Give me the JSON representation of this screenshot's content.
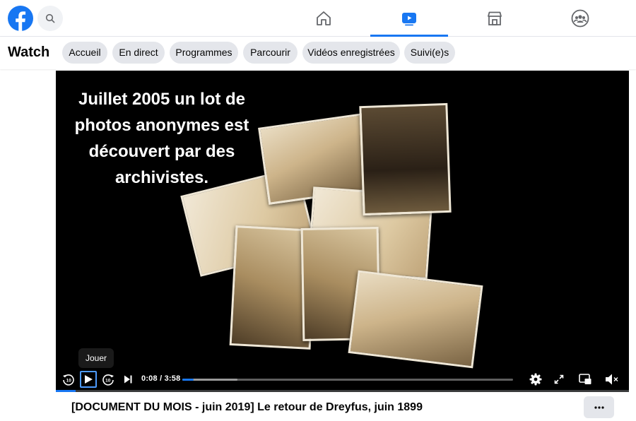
{
  "nav": {
    "tabs": [
      {
        "icon": "home-icon",
        "active": false
      },
      {
        "icon": "watch-icon",
        "active": true
      },
      {
        "icon": "marketplace-icon",
        "active": false
      },
      {
        "icon": "groups-icon",
        "active": false
      }
    ]
  },
  "watch": {
    "title": "Watch",
    "pills": [
      "Accueil",
      "En direct",
      "Programmes",
      "Parcourir",
      "Vidéos enregistrées",
      "Suivi(e)s"
    ]
  },
  "video": {
    "overlay_text": [
      "Juillet 2005 un lot de",
      "photos anonymes est",
      "découvert par des",
      "archivistes."
    ],
    "tooltip": "Jouer",
    "current_time": "0:08",
    "duration": "3:58",
    "progress_fraction": 0.034,
    "title": "[DOCUMENT DU MOIS - juin 2019] Le retour de Dreyfus, juin 1899"
  },
  "colors": {
    "accent": "#1877f2",
    "pill_bg": "#e4e6eb"
  }
}
